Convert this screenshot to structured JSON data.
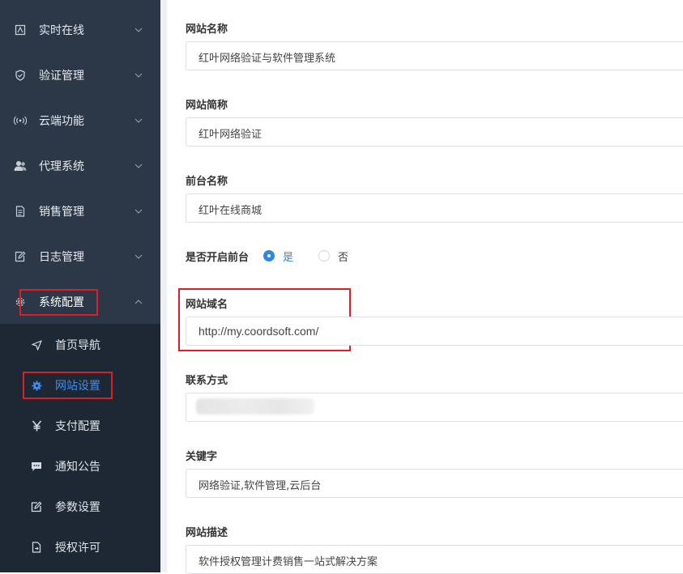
{
  "sidebar": {
    "items": [
      {
        "label": "实时在线",
        "icon": "monitor-icon"
      },
      {
        "label": "验证管理",
        "icon": "shield-icon"
      },
      {
        "label": "云端功能",
        "icon": "broadcast-icon"
      },
      {
        "label": "代理系统",
        "icon": "users-icon"
      },
      {
        "label": "销售管理",
        "icon": "document-icon"
      },
      {
        "label": "日志管理",
        "icon": "edit-log-icon"
      },
      {
        "label": "系统配置",
        "icon": "gear-icon"
      }
    ],
    "submenu": [
      {
        "label": "首页导航",
        "icon": "navigation-icon"
      },
      {
        "label": "网站设置",
        "icon": "cog-icon"
      },
      {
        "label": "支付配置",
        "icon": "yen-icon"
      },
      {
        "label": "通知公告",
        "icon": "chat-icon"
      },
      {
        "label": "参数设置",
        "icon": "edit-icon"
      },
      {
        "label": "授权许可",
        "icon": "license-icon"
      }
    ],
    "active_submenu": "网站设置"
  },
  "form": {
    "site_name": {
      "label": "网站名称",
      "value": "红叶网络验证与软件管理系统"
    },
    "site_short": {
      "label": "网站简称",
      "value": "红叶网络验证"
    },
    "front_name": {
      "label": "前台名称",
      "value": "红叶在线商城"
    },
    "front_toggle": {
      "label": "是否开启前台",
      "yes": "是",
      "no": "否",
      "selected": "是"
    },
    "domain": {
      "label": "网站域名",
      "value": "http://my.coordsoft.com/"
    },
    "contact": {
      "label": "联系方式",
      "value": ""
    },
    "keywords": {
      "label": "关键字",
      "value": "网络验证,软件管理,云后台"
    },
    "description": {
      "label": "网站描述",
      "value": "软件授权管理计费销售一站式解决方案"
    }
  },
  "colors": {
    "sidebar": "#2c3848",
    "submenu": "#1e2734",
    "accent": "#2f86e6",
    "highlight": "#d8202a"
  }
}
